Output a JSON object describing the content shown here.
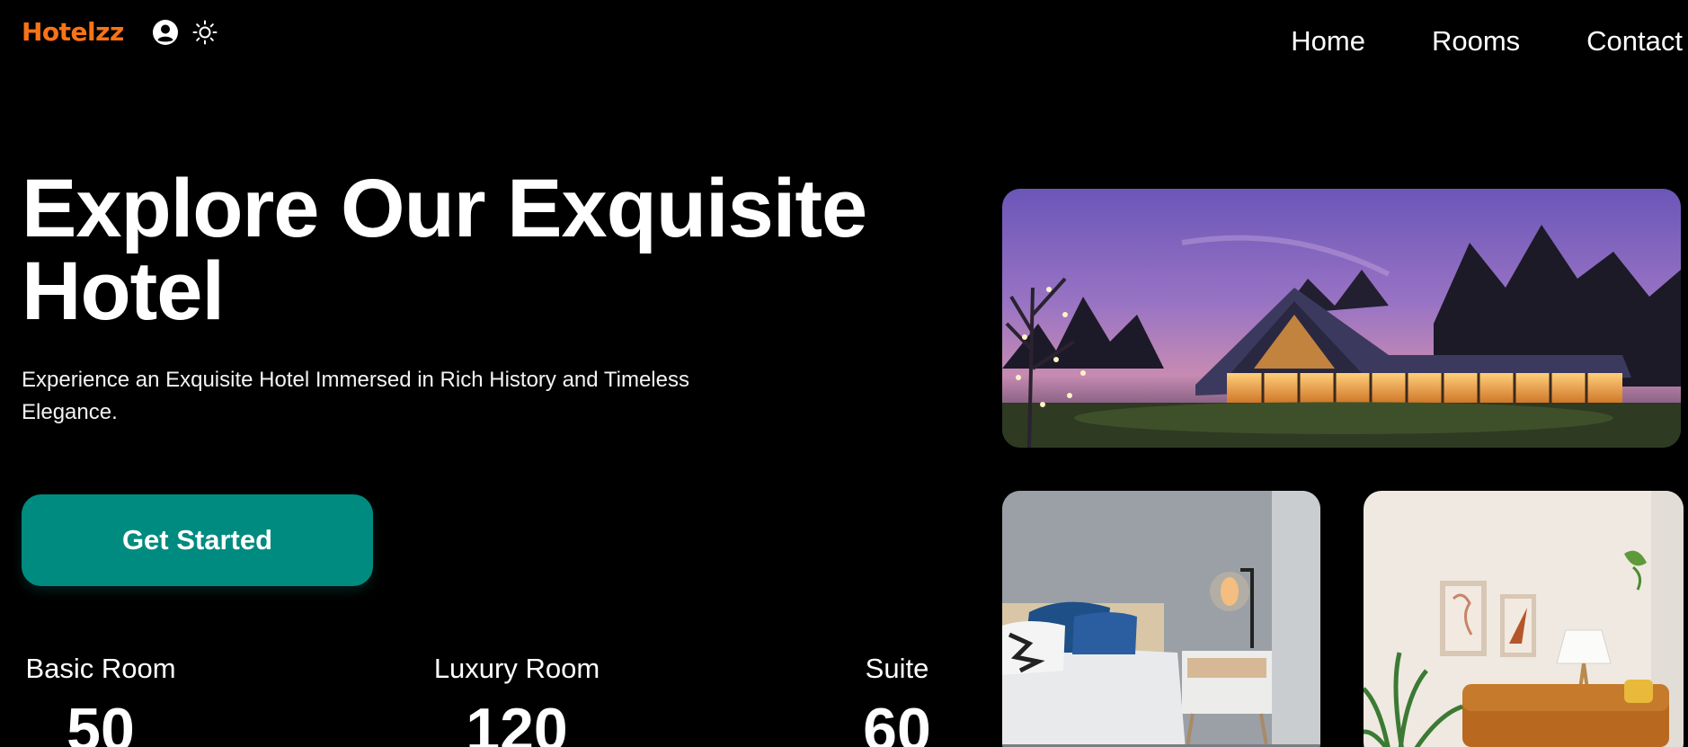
{
  "brand": {
    "name": "Hotelzz",
    "color": "#f97316"
  },
  "header_icons": [
    "user-circle-icon",
    "sun-icon"
  ],
  "nav": {
    "links": [
      "Home",
      "Rooms",
      "Contact"
    ]
  },
  "hero": {
    "title": "Explore Our Exquisite Hotel",
    "subtitle": "Experience an Exquisite Hotel Immersed in Rich History and Timeless Elegance.",
    "cta_label": "Get Started",
    "cta_color": "#008b80"
  },
  "stats": [
    {
      "label": "Basic Room",
      "value": "50"
    },
    {
      "label": "Luxury Room",
      "value": "120"
    },
    {
      "label": "Suite",
      "value": "60"
    }
  ]
}
